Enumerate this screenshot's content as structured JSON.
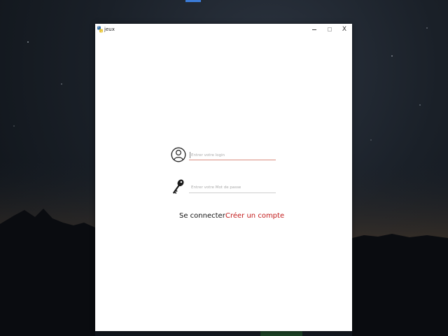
{
  "window": {
    "title": "jeux",
    "minimize": "–",
    "maximize": "□",
    "close": "X"
  },
  "form": {
    "login_placeholder": "Entrer votre login",
    "password_placeholder": "Entrer votre Mot de passe",
    "connect_label": "Se connecter",
    "create_account_label": "Créer un compte"
  },
  "colors": {
    "create_account": "#c21a1a",
    "login_underline": "#d98b7e"
  }
}
